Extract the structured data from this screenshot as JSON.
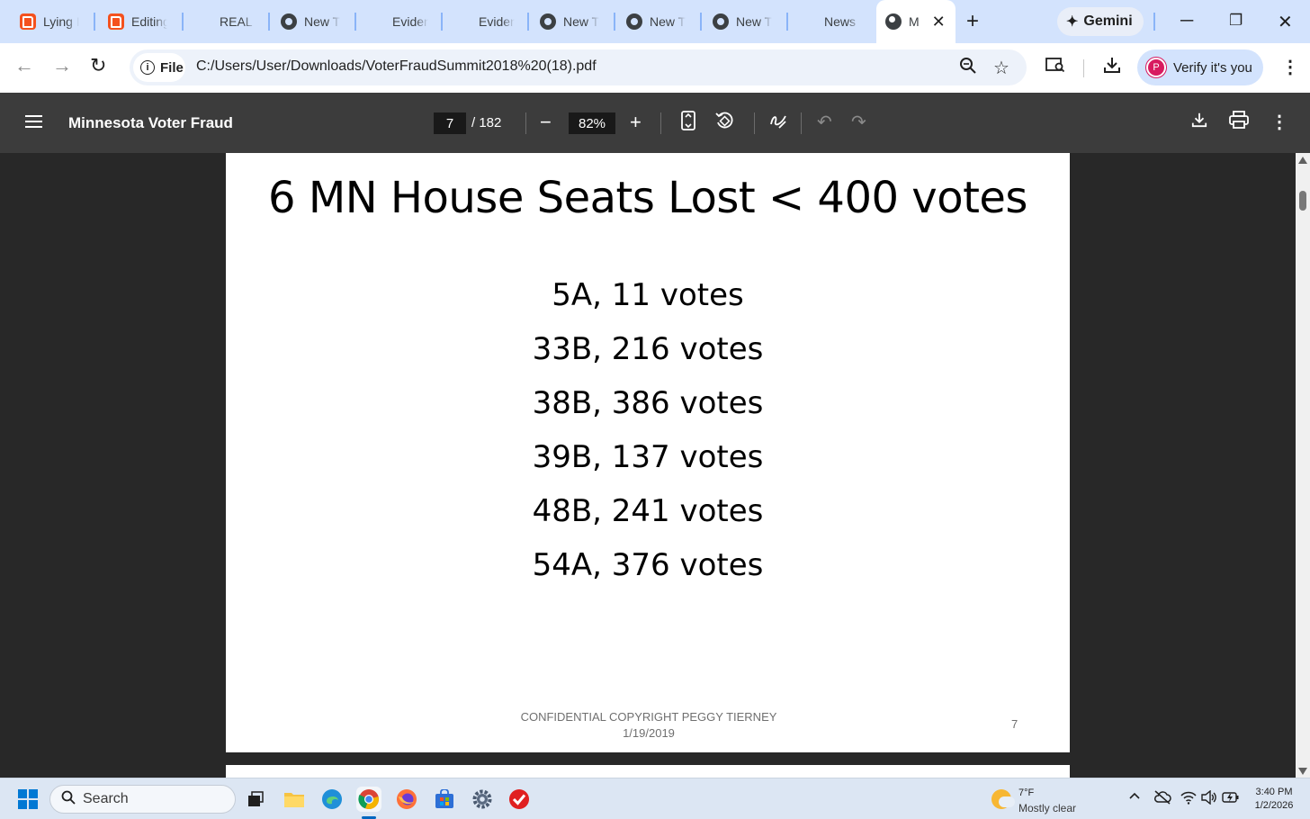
{
  "browser": {
    "tabs": [
      {
        "title": "Lying I",
        "icon": "blogger-icon"
      },
      {
        "title": "Editing",
        "icon": "blogger-icon"
      },
      {
        "title": "REAL I",
        "icon": "none"
      },
      {
        "title": "New T",
        "icon": "chrome-icon"
      },
      {
        "title": "Eviden",
        "icon": "none"
      },
      {
        "title": "Eviden",
        "icon": "none"
      },
      {
        "title": "New T",
        "icon": "chrome-icon"
      },
      {
        "title": "New T",
        "icon": "chrome-icon"
      },
      {
        "title": "New T",
        "icon": "chrome-icon"
      },
      {
        "title": "News",
        "icon": "none"
      },
      {
        "title": "M",
        "icon": "globe-icon",
        "active": true
      }
    ],
    "new_tab_glyph": "+",
    "gemini_label": "Gemini",
    "url_chip_label": "File",
    "url": "C:/Users/User/Downloads/VoterFraudSummit2018%20(18).pdf",
    "verify_label": "Verify it's you",
    "avatar_letter": "P",
    "colors": {
      "tabstrip": "#d3e3fd",
      "avatar": "#d81b60",
      "pdf_toolbar": "#3c3c3c",
      "viewer_bg": "#282828"
    }
  },
  "pdf_toolbar": {
    "document_title": "Minnesota Voter Fraud",
    "current_page": "7",
    "total_pages": "/ 182",
    "zoom": "82%"
  },
  "slide": {
    "title": "6 MN House Seats Lost < 400 votes",
    "lines": [
      "5A, 11 votes",
      "33B, 216 votes",
      "38B, 386 votes",
      "39B, 137 votes",
      "48B, 241 votes",
      "54A, 376 votes"
    ],
    "footer_line1": "CONFIDENTIAL COPYRIGHT PEGGY TIERNEY",
    "footer_line2": "1/19/2019",
    "page_number": "7"
  },
  "taskbar": {
    "search_placeholder": "Search",
    "weather_temp": "7°F",
    "weather_condition": "Mostly clear",
    "time": "3:40 PM",
    "date": "1/2/2026"
  }
}
